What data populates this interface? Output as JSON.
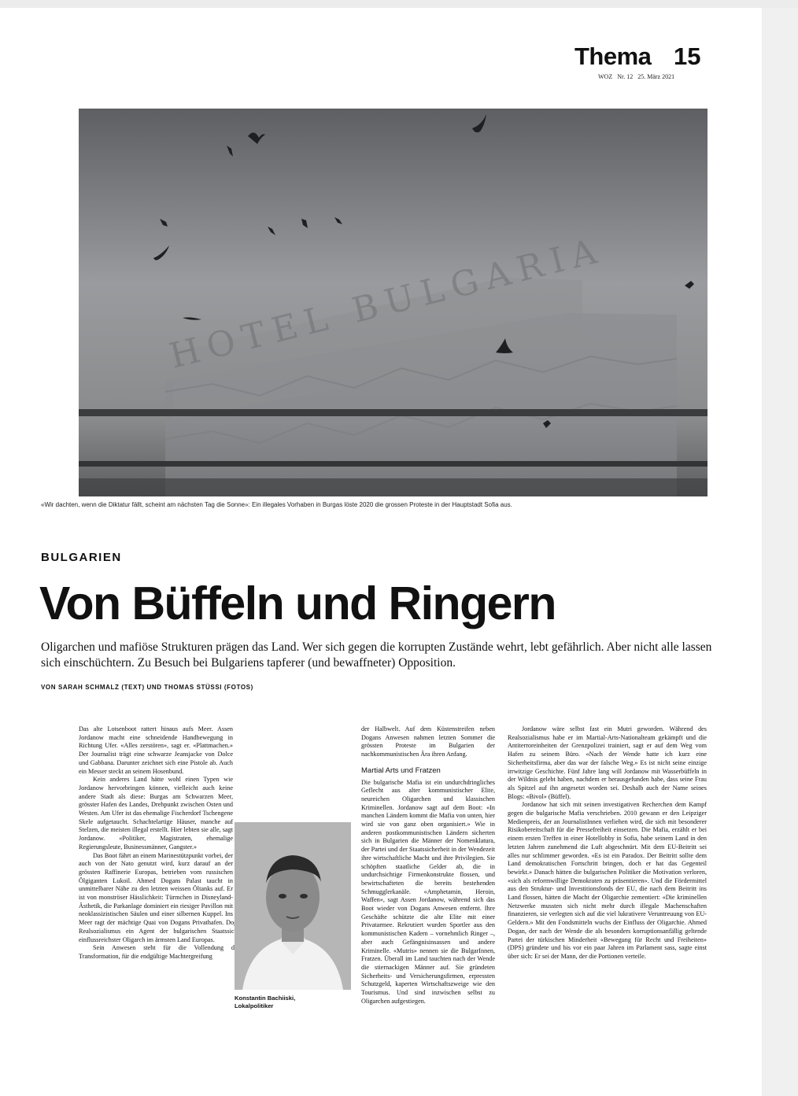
{
  "header": {
    "section": "Thema",
    "page_number": "15",
    "publication": "WOZ",
    "issue": "Nr. 12",
    "date": "25. März 2021"
  },
  "photo": {
    "sign_text": "HOTEL BULGARIA",
    "caption": "«Wir dachten, wenn die Diktatur fällt, scheint am nächsten Tag die Sonne»: Ein illegales Vorhaben in Burgas löste 2020 die grossen Proteste in der Hauptstadt Sofia aus."
  },
  "article": {
    "kicker": "BULGARIEN",
    "title": "Von Büffeln und Ringern",
    "lead": "Oligarchen und mafiöse Strukturen prägen das Land. Wer sich gegen die korrupten Zustände wehrt, lebt gefährlich. Aber nicht alle lassen sich einschüchtern. Zu Besuch bei Bulgariens tapferer (und bewaffneter) Opposition.",
    "byline": "VON SARAH SCHMALZ (TEXT) UND THOMAS STÜSSI (FOTOS)",
    "col1": {
      "p1": "Das alte Lotsenboot rattert hinaus aufs Meer. Assen Jordanow macht eine schneidende Handbewegung in Richtung Ufer. «Alles zerstören», sagt er. «Plattmachen.» Der Journalist trägt eine schwarze Jeansjacke von Dolce und Gabbana. Darunter zeichnet sich eine Pistole ab. Auch ein Messer steckt an seinem Hosenbund.",
      "p2a": "Kein anderes Land hätte wohl einen Typen wie Jordanow hervorbringen können, vielleicht auch keine andere Stadt als diese: Burgas am Schwarzen Meer, grösster Hafen des Landes, Drehpunkt zwischen Osten und Westen. Am Ufer ist das ehemalige Fischerdorf Tschengene Skele aufgetaucht. Schachtelartige Häuser, manche auf Stelzen, die meisten illegal erstellt. Hier lebten sie alle, sagt Jordanow. «Politiker, Magistraten, ehemalige Regierungsleute, Businessmänner, Gangster.»",
      "p3": "Das Boot fährt an einem Marinestützpunkt vorbei, der auch von der Nato genutzt wird, kurz darauf an der grössten Raffinerie Europas, betrieben vom russischen Ölgiganten Lukoil. Ahmed Dogans Palast taucht in unmittelbarer Nähe zu den letzten weissen Öltanks auf. Er ist von monströser Hässlichkeit: Türmchen in Disneyland-Ästhetik, die Parkanlage dominiert ein riesiger Pavillon mit neoklassizistischen Säulen und einer silbernen Kuppel. Ins Meer ragt der mächtige Quai von Dogans Privathafen. Dogan, während des Realsozialismus ein Agent der bulgarischen Staatssicherheit, gilt als einflussreichster Oligarch im ärmsten Land Europas.",
      "p4": "Sein Anwesen steht für die Vollendung der bulgarischen Transformation, für die endgültige Machtergreifung"
    },
    "portrait": {
      "caption_name": "Konstantin Bachiiski,",
      "caption_role": "Lokalpolitiker"
    },
    "col2": {
      "p1": "der Halbwelt. Auf dem Küstenstreifen neben Dogans Anwesen nahmen letzten Sommer die grössten Proteste im Bulgarien der nachkommunistischen Ära ihren Anfang.",
      "subhead": "Martial Arts und Fratzen",
      "p2": "Die bulgarische Mafia ist ein undurchdringliches Geflecht aus alter kommunistischer Elite, neureichen Oligarchen und klassischen Kriminellen. Jordanow sagt auf dem Boot: «In manchen Ländern kommt die Mafia von unten, hier wird sie von ganz oben organisiert.» Wie in anderen postkommunistischen Ländern sicherten sich in Bulgarien die Männer der Nomenklatura, der Partei und der Staatssicherheit in der Wendezeit ihre wirtschaftliche Macht und ihre Privilegien. Sie schöpften staatliche Gelder ab, die in undurchsichtige Firmenkonstrukte flossen, und bewirtschafteten die bereits bestehenden Schmugglerkanäle. «Amphetamin, Heroin, Waffen», sagt Assen Jordanow, während sich das Boot wieder von Dogans Anwesen entfernt. Ihre Geschäfte schützte die alte Elite mit einer Privatarmee. Rekrutiert wurden Sportler aus den kommunistischen Kadern – vornehmlich Ringer –, aber auch Gefängnisinsassen und andere Kriminelle. «Mutris» nennen sie die BulgarInnen, Fratzen. Überall im Land tauchten nach der Wende die stiernackigen Männer auf. Sie gründeten Sicherheits- und Versicherungsfirmen, erpressten Schutzgeld, kaperten Wirtschaftszweige wie den Tourismus. Und sind inzwischen selbst zu Oligarchen aufgestiegen."
    },
    "col3": {
      "p1": "Jordanow wäre selbst fast ein Mutri geworden. Während des Realsozialismus habe er im Martial-Arts-Nationalteam gekämpft und die Antiterroreinheiten der Grenzpolizei trainiert, sagt er auf dem Weg vom Hafen zu seinem Büro. «Nach der Wende hatte ich kurz eine Sicherheitsfirma, aber das war der falsche Weg.» Es ist nicht seine einzige irrwitzige Geschichte. Fünf Jahre lang will Jordanow mit Wasserbüffeln in der Wildnis gelebt haben, nachdem er herausgefunden habe, dass seine Frau als Spitzel auf ihn angesetzt worden sei. Deshalb auch der Name seines Blogs: «Bivol» (Büffel).",
      "p2": "Jordanow hat sich mit seinen investigativen Recherchen dem Kampf gegen die bulgarische Mafia verschrieben. 2010 gewann er den Leipziger Medienpreis, der an JournalistInnen verliehen wird, die sich mit besonderer Risikobereitschaft für die Pressefreiheit einsetzen. Die Mafia, erzählt er bei einem ersten Treffen in einer Hotellobby in Sofia, habe seinem Land in den letzten Jahren zunehmend die Luft abgeschnürt. Mit dem EU-Beitritt sei alles nur schlimmer geworden. «Es ist ein Paradox. Der Beitritt sollte dem Land demokratischen Fortschritt bringen, doch er hat das Gegenteil bewirkt.» Danach hätten die bulgarischen Politiker die Motivation verloren, «sich als reformwillige Demokraten zu präsentieren». Und die Fördermittel aus den Struktur- und Investitionsfonds der EU, die nach dem Beitritt ins Land flossen, hätten die Macht der Oligarchie zementiert: «Die kriminellen Netzwerke mussten sich nicht mehr durch illegale Machenschaften finanzieren, sie verlegten sich auf die viel lukrativere Veruntreuung von EU-Geldern.» Mit den Fondsmitteln wuchs der Einfluss der Oligarchie. Ahmed Dogan, der nach der Wende die als besonders korruptionsanfällig geltende Partei der türkischen Minderheit «Bewegung für Recht und Freiheiten» (DPS) gründete und bis vor ein paar Jahren im Parlament sass, sagte einst über sich: Er sei der Mann, der die Portionen verteile."
    }
  }
}
